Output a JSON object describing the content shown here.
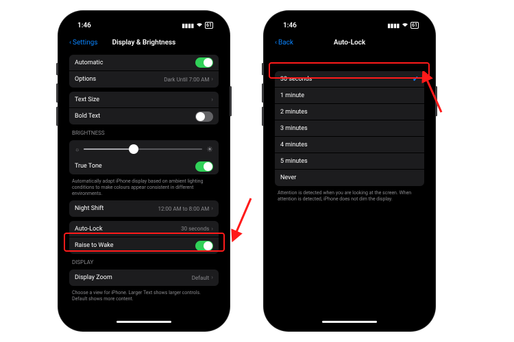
{
  "status": {
    "time": "1:46",
    "battery": "61"
  },
  "left": {
    "nav": {
      "back": "Settings",
      "title": "Display & Brightness"
    },
    "rows": {
      "automatic": "Automatic",
      "options": "Options",
      "options_value": "Dark Until 7:00 AM",
      "text_size": "Text Size",
      "bold_text": "Bold Text",
      "brightness_header": "BRIGHTNESS",
      "true_tone": "True Tone",
      "true_tone_footer": "Automatically adapt iPhone display based on ambient lighting conditions to make colours appear consistent in different environments.",
      "night_shift": "Night Shift",
      "night_shift_value": "12:00 AM to 8:00 AM",
      "auto_lock": "Auto-Lock",
      "auto_lock_value": "30 seconds",
      "raise_to_wake": "Raise to Wake",
      "display_header": "DISPLAY",
      "display_zoom": "Display Zoom",
      "display_zoom_value": "Default",
      "display_zoom_footer": "Choose a view for iPhone. Larger Text shows larger controls. Default shows more content."
    },
    "brightness_pct": 42
  },
  "right": {
    "nav": {
      "back": "Back",
      "title": "Auto-Lock"
    },
    "options": [
      "30 seconds",
      "1 minute",
      "2 minutes",
      "3 minutes",
      "4 minutes",
      "5 minutes",
      "Never"
    ],
    "selected_index": 0,
    "footer": "Attention is detected when you are looking at the screen. When attention is detected, iPhone does not dim the display."
  }
}
